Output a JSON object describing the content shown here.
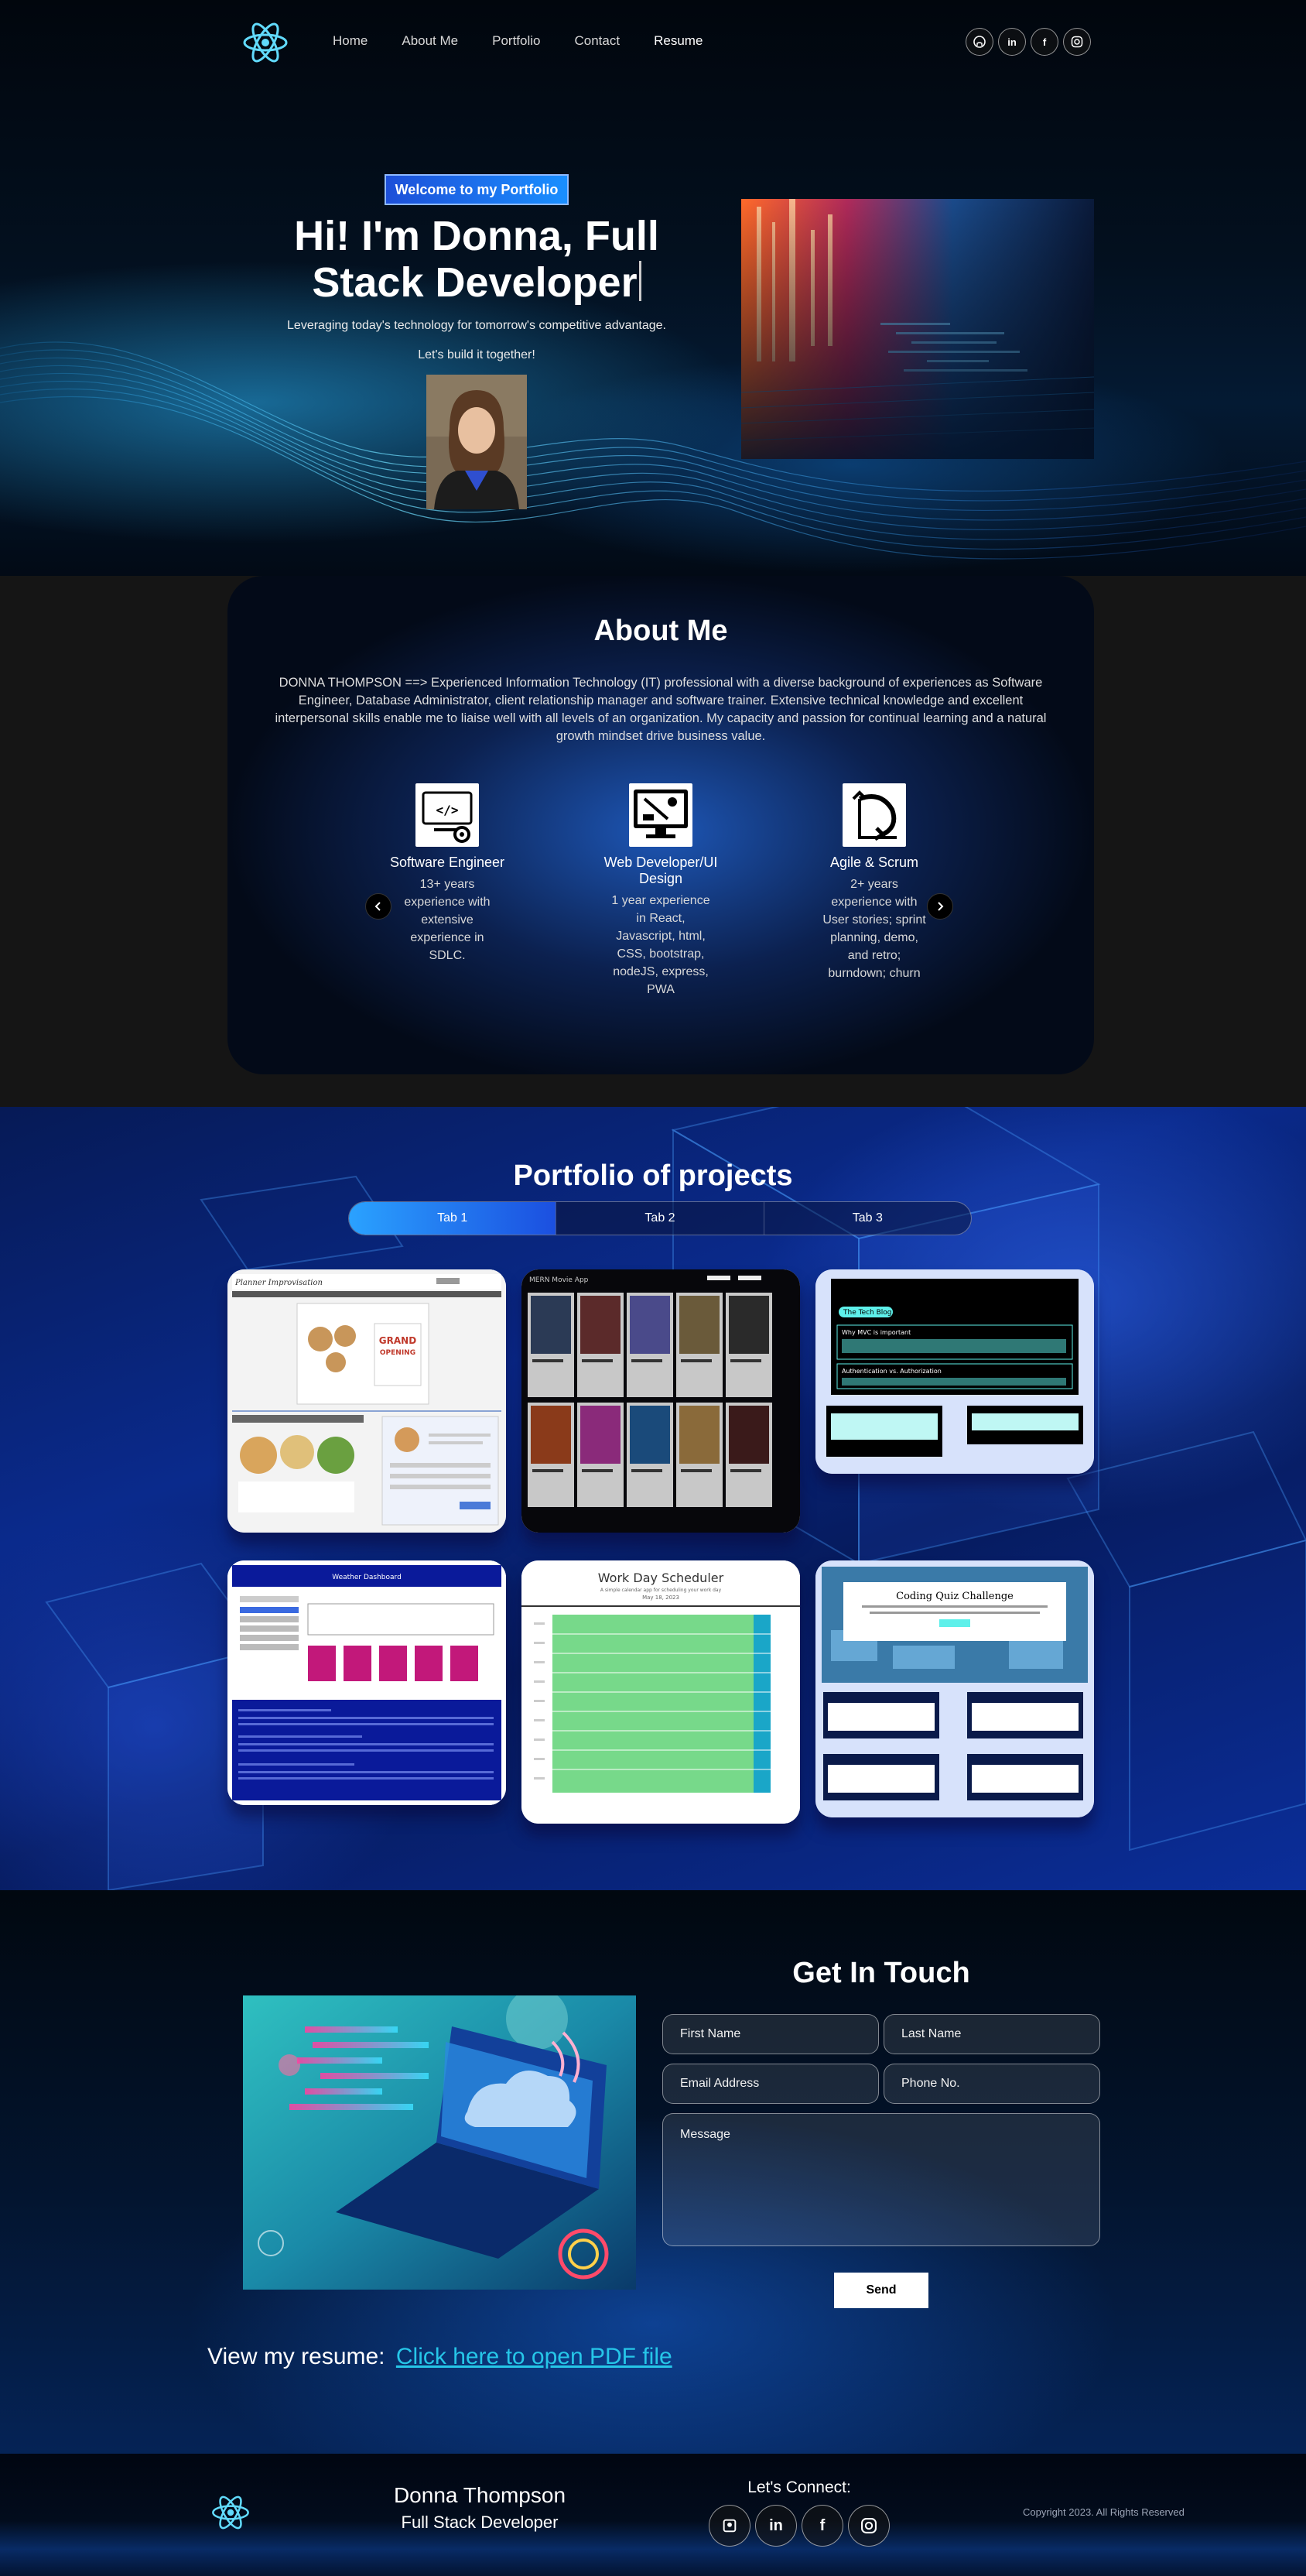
{
  "nav": {
    "links": [
      "Home",
      "About Me",
      "Portfolio",
      "Contact",
      "Resume"
    ],
    "social": [
      "github-icon",
      "linkedin-icon",
      "facebook-icon",
      "instagram-icon"
    ]
  },
  "hero": {
    "tagline": "Welcome to my Portfolio",
    "title": "Hi! I'm Donna, Full Stack Developer",
    "subtitle": "Leveraging today's technology for tomorrow's competitive advantage.",
    "cta": "Let's build it together!"
  },
  "about": {
    "title": "About Me",
    "text": "DONNA THOMPSON ==> Experienced Information Technology (IT) professional with a diverse background of experiences as Software Engineer, Database Administrator, client relationship manager and software trainer. Extensive technical knowledge and excellent interpersonal skills enable me to liaise well with all levels of an organization. My capacity and passion for continual learning and a natural growth mindset drive business value.",
    "skills": [
      {
        "title": "Software Engineer",
        "desc": "13+ years experience with extensive experience in SDLC.",
        "icon": "code-gear-icon"
      },
      {
        "title": "Web Developer/UI Design",
        "desc": "1 year experience in React, Javascript, html, CSS, bootstrap, nodeJS, express, PWA",
        "icon": "monitor-tools-icon"
      },
      {
        "title": "Agile & Scrum",
        "desc": "2+ years experience with User stories; sprint planning, demo, and retro; burndown; churn",
        "icon": "agile-cycle-icon"
      }
    ]
  },
  "portfolio": {
    "title": "Portfolio of projects",
    "tabs": [
      "Tab 1",
      "Tab 2",
      "Tab 3"
    ],
    "project_titles": {
      "p1": "Planner Improvisation",
      "p2": "MERN Movie App",
      "p3": "The Tech Blog",
      "p3_line1": "Why MVC is important",
      "p3_line2": "Authentication vs. Authorization",
      "p4": "Weather Dashboard",
      "p5": "Work Day Scheduler",
      "p5_sub": "A simple calendar app for scheduling your work day",
      "p5_date": "May 18, 2023",
      "p6": "Coding Quiz Challenge",
      "p3_badge": "The Tech Blog"
    }
  },
  "contact": {
    "title": "Get In Touch",
    "first_name": "First Name",
    "last_name": "Last Name",
    "email": "Email Address",
    "phone": "Phone No.",
    "message": "Message",
    "send": "Send",
    "resume_label": "View my resume:",
    "resume_link": "Click here to open PDF file"
  },
  "footer": {
    "name": "Donna Thompson",
    "role": "Full Stack Developer",
    "connect": "Let's Connect:",
    "copyright": "Copyright 2023. All Rights Reserved"
  },
  "colors": {
    "accent": "#1a8fff",
    "link": "#26c6e8"
  }
}
